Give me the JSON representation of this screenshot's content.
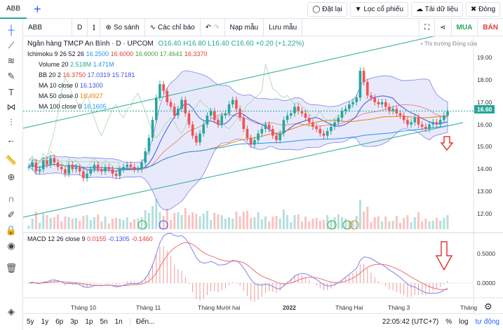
{
  "tab": "ABB",
  "top_buttons": [
    {
      "icon": "reset-icon",
      "label": "Đặt lại"
    },
    {
      "icon": "filter-icon",
      "label": "Lọc cổ phiếu"
    },
    {
      "icon": "cloud-download-icon",
      "label": "Tải dữ liệu"
    },
    {
      "icon": "close-icon",
      "label": "Đóng"
    }
  ],
  "toolbar": {
    "symbol": "ABB",
    "interval": "D",
    "compare": "So sánh",
    "indicators": "Các chỉ báo",
    "load_template": "Nạp mẫu",
    "save_template": "Lưu mẫu",
    "buy": "MUA",
    "sell": "BÁN"
  },
  "legend": {
    "title": "Ngân hàng TMCP An Bình · D · UPCOM",
    "ohlc": "O16.40 H16.80 L16.40 C16.60 +0.20 (+1.22%)",
    "market_status": "• Thị trường Đóng cửa",
    "ichimoku": {
      "label": "Ichimoku 9 26 52 26",
      "v": [
        "16.2500",
        "16.6000",
        "16.6000",
        "17.4641",
        "16.3370"
      ]
    },
    "volume": {
      "label": "Volume 20",
      "v": [
        "2.518M",
        "1.471M"
      ]
    },
    "bb": {
      "label": "BB 20 2",
      "v": [
        "16.3750",
        "17.0319",
        "15.7181"
      ]
    },
    "ma10": {
      "label": "MA 10 close 0",
      "v": "16.1300"
    },
    "ma50": {
      "label": "MA 50 close 0",
      "v": "16.4927"
    },
    "ma100": {
      "label": "MA 100 close 0",
      "v": "16.1605"
    },
    "macd": {
      "label": "MACD 12 26 close 9",
      "v": [
        "0.0155",
        "-0.1305",
        "-0.1460"
      ]
    }
  },
  "price_axis": [
    "19.00",
    "18.00",
    "17.00",
    "16.00",
    "15.00",
    "14.00",
    "13.00",
    "12.00"
  ],
  "last_price": "16.60",
  "macd_axis": [
    "0.5000",
    "0.0000"
  ],
  "time_axis": [
    "Tháng 10",
    "Tháng 11",
    "Tháng Mười hai",
    "2022",
    "Tháng Hai",
    "Tháng 3",
    "Tháng"
  ],
  "bottom": {
    "ranges": [
      "5y",
      "1y",
      "6p",
      "3p",
      "1p",
      "5n",
      "1n"
    ],
    "goto": "Đến...",
    "time": "22:05:42 (UTC+7)",
    "pct": "%",
    "log": "log",
    "auto": "tự động"
  },
  "chart_data": {
    "type": "candlestick",
    "closes": [
      14.1,
      14.3,
      13.9,
      14.0,
      14.4,
      14.2,
      14.5,
      14.3,
      14.1,
      14.0,
      13.8,
      14.2,
      14.0,
      14.1,
      13.9,
      13.6,
      13.8,
      14.0,
      14.2,
      14.0,
      13.9,
      14.1,
      14.0,
      13.8,
      13.7,
      14.0,
      14.1,
      14.2,
      14.1,
      14.0,
      14.0,
      14.3,
      14.8,
      15.4,
      16.2,
      17.2,
      17.8,
      17.5,
      17.0,
      16.8,
      16.4,
      16.7,
      17.1,
      16.5,
      16.0,
      15.5,
      15.2,
      15.6,
      16.0,
      16.4,
      16.6,
      16.2,
      16.0,
      16.4,
      16.5,
      16.9,
      17.1,
      16.7,
      16.3,
      15.8,
      15.4,
      15.1,
      15.3,
      15.6,
      15.8,
      16.0,
      15.8,
      15.5,
      15.3,
      15.6,
      16.2,
      16.4,
      16.5,
      16.8,
      16.6,
      16.5,
      16.3,
      16.1,
      15.9,
      15.8,
      15.6,
      15.5,
      15.7,
      15.9,
      16.1,
      16.3,
      16.6,
      16.7,
      16.9,
      17.0,
      17.2,
      18.4,
      17.9,
      17.3,
      17.2,
      17.0,
      16.9,
      17.0,
      16.8,
      16.6,
      16.7,
      16.5,
      16.4,
      16.2,
      16.0,
      16.1,
      16.3,
      16.0,
      15.9,
      15.8,
      16.0,
      16.1,
      16.0,
      16.2,
      16.4,
      16.6
    ],
    "ylim": [
      11.6,
      19.8
    ],
    "macd_ylim": [
      -0.3,
      0.8
    ]
  }
}
